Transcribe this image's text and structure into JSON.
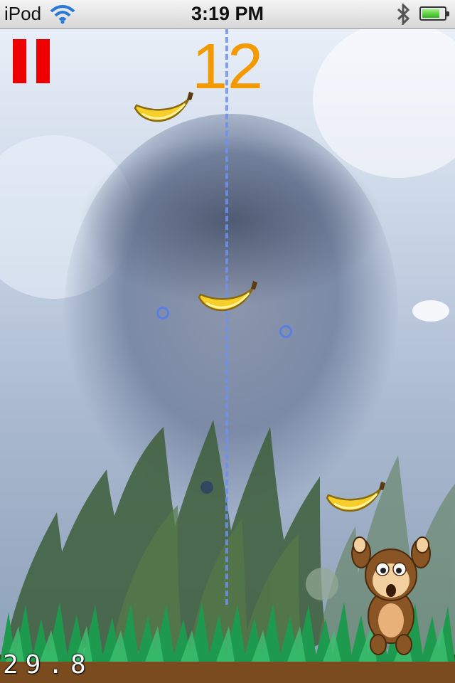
{
  "status_bar": {
    "carrier": "iPod",
    "time": "3:19 PM",
    "icons": [
      "wifi-icon",
      "bluetooth-icon",
      "battery-icon"
    ],
    "battery_level": 0.8
  },
  "hud": {
    "score": "12",
    "timer": "29.8",
    "pause_color": "#ee0000",
    "score_color": "#f29a00"
  },
  "game": {
    "bananas_visible": 3,
    "character": "monkey"
  }
}
